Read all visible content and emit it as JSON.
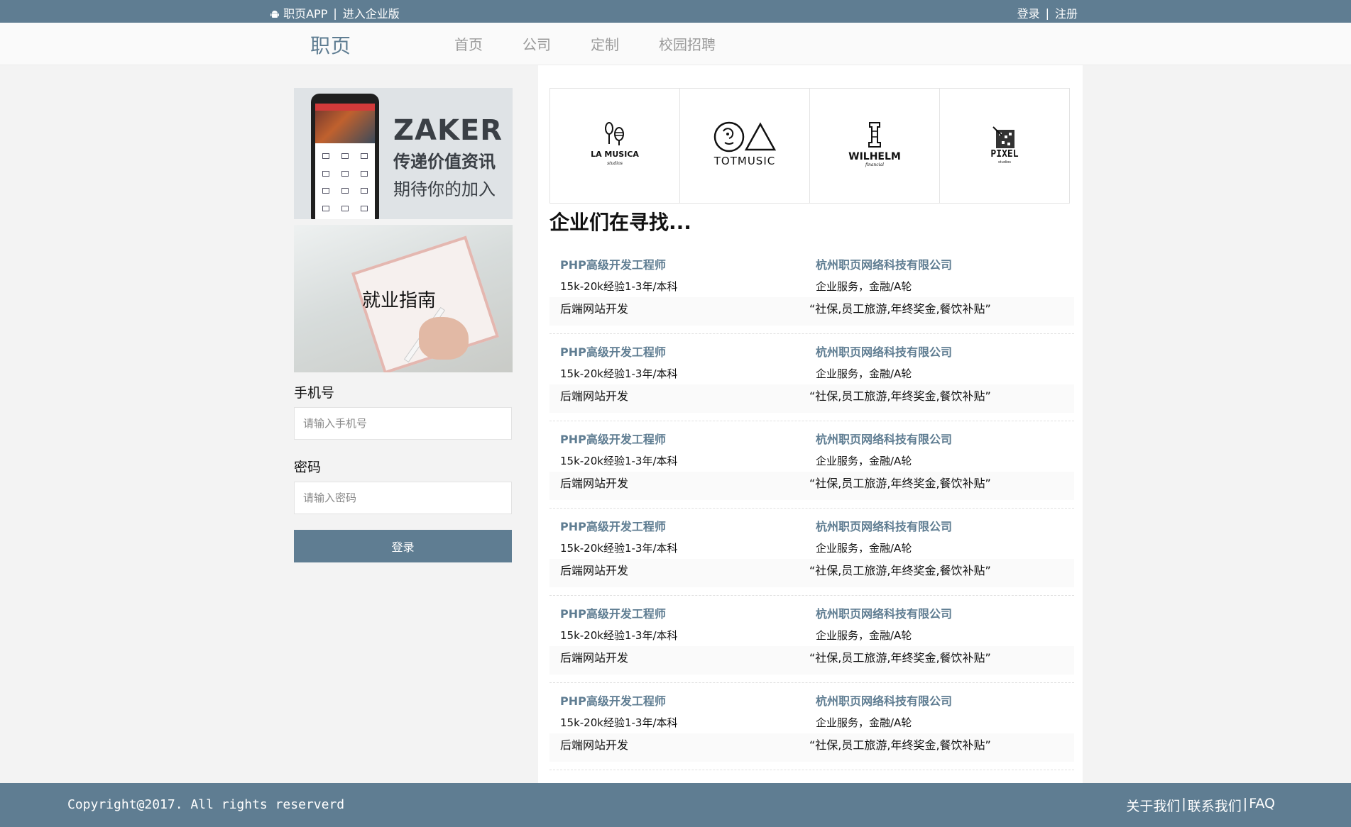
{
  "topbar": {
    "app_label": "职页APP",
    "separator": "|",
    "enterprise_label": "进入企业版",
    "login_label": "登录",
    "register_label": "注册"
  },
  "nav": {
    "brand": "职页",
    "links": [
      "首页",
      "公司",
      "定制",
      "校园招聘"
    ]
  },
  "sidebar": {
    "zaker": {
      "title": "ZAKER",
      "line1": "传递价值资讯",
      "line2": "期待你的加入"
    },
    "guide_text": "就业指南",
    "phone_label": "手机号",
    "phone_placeholder": "请输入手机号",
    "password_label": "密码",
    "password_placeholder": "请输入密码",
    "login_button": "登录"
  },
  "logos": [
    {
      "name": "LA MUSICA",
      "sub": "studios",
      "icon": "maraca-icon"
    },
    {
      "name": "TOTMUSIC",
      "sub": "",
      "icon": "circle-triangle-icon"
    },
    {
      "name": "WILHELM",
      "sub": "financial",
      "icon": "chess-rook-icon"
    },
    {
      "name": "PIXEL",
      "sub": "studios",
      "icon": "pixel-square-icon"
    }
  ],
  "section_title": "企业们在寻找...",
  "jobs": [
    {
      "title": "PHP高级开发工程师",
      "company": "杭州职页网络科技有限公司",
      "meta": "15k-20k经验1-3年/本科",
      "industry": "企业服务，金融/A轮",
      "category": "后端网站开发",
      "benefits": "“社保,员工旅游,年终奖金,餐饮补贴”"
    },
    {
      "title": "PHP高级开发工程师",
      "company": "杭州职页网络科技有限公司",
      "meta": "15k-20k经验1-3年/本科",
      "industry": "企业服务，金融/A轮",
      "category": "后端网站开发",
      "benefits": "“社保,员工旅游,年终奖金,餐饮补贴”"
    },
    {
      "title": "PHP高级开发工程师",
      "company": "杭州职页网络科技有限公司",
      "meta": "15k-20k经验1-3年/本科",
      "industry": "企业服务，金融/A轮",
      "category": "后端网站开发",
      "benefits": "“社保,员工旅游,年终奖金,餐饮补贴”"
    },
    {
      "title": "PHP高级开发工程师",
      "company": "杭州职页网络科技有限公司",
      "meta": "15k-20k经验1-3年/本科",
      "industry": "企业服务，金融/A轮",
      "category": "后端网站开发",
      "benefits": "“社保,员工旅游,年终奖金,餐饮补贴”"
    },
    {
      "title": "PHP高级开发工程师",
      "company": "杭州职页网络科技有限公司",
      "meta": "15k-20k经验1-3年/本科",
      "industry": "企业服务，金融/A轮",
      "category": "后端网站开发",
      "benefits": "“社保,员工旅游,年终奖金,餐饮补贴”"
    },
    {
      "title": "PHP高级开发工程师",
      "company": "杭州职页网络科技有限公司",
      "meta": "15k-20k经验1-3年/本科",
      "industry": "企业服务，金融/A轮",
      "category": "后端网站开发",
      "benefits": "“社保,员工旅游,年终奖金,餐饮补贴”"
    }
  ],
  "footer": {
    "copyright": "Copyright@2017. All rights reserverd",
    "about": "关于我们",
    "contact": "联系我们",
    "faq": "FAQ",
    "divider": "|"
  },
  "colors": {
    "primary": "#5f7d92",
    "page_bg": "#f3f3f3"
  }
}
